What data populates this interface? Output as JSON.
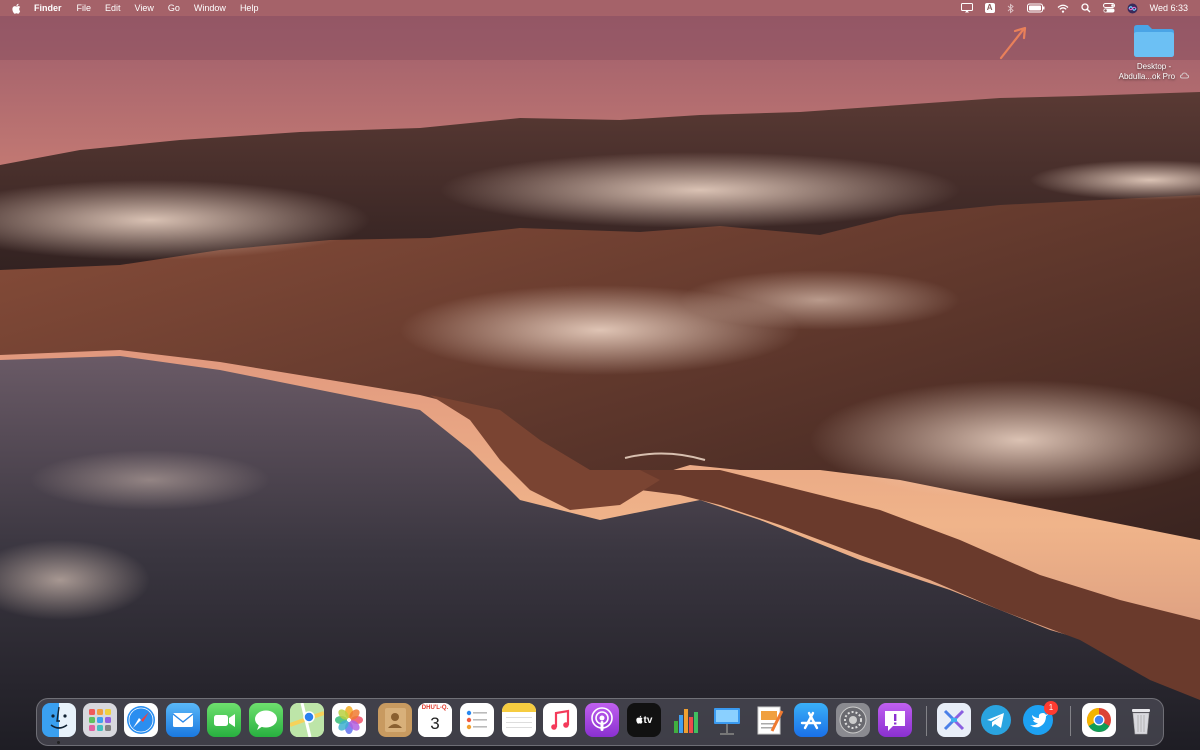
{
  "menubar": {
    "apple_icon": "apple-logo-icon",
    "app_name": "Finder",
    "menus": [
      "File",
      "Edit",
      "View",
      "Go",
      "Window",
      "Help"
    ],
    "status_icons": [
      "screen-mirroring-icon",
      "input-source-icon",
      "bluetooth-icon",
      "battery-icon",
      "wifi-icon",
      "spotlight-search-icon",
      "control-center-icon",
      "siri-icon"
    ],
    "input_source": "A",
    "clock": "Wed 6:33"
  },
  "desktop": {
    "items": [
      {
        "label_line1": "Desktop -",
        "label_line2": "Abdulla...ok Pro",
        "icon": "folder-icon",
        "status_icon": "icloud-icon"
      }
    ]
  },
  "annotation": {
    "icon": "arrow-icon",
    "color": "#e9805a"
  },
  "dock": {
    "apps": [
      {
        "name": "Finder",
        "icon": "finder-icon",
        "running": true
      },
      {
        "name": "Launchpad",
        "icon": "launchpad-icon"
      },
      {
        "name": "Safari",
        "icon": "safari-icon"
      },
      {
        "name": "Mail",
        "icon": "mail-icon"
      },
      {
        "name": "FaceTime",
        "icon": "facetime-icon"
      },
      {
        "name": "Messages",
        "icon": "messages-icon"
      },
      {
        "name": "Maps",
        "icon": "maps-icon"
      },
      {
        "name": "Photos",
        "icon": "photos-icon"
      },
      {
        "name": "Contacts",
        "icon": "contacts-icon"
      },
      {
        "name": "Calendar",
        "icon": "calendar-icon",
        "month": "DHU'L-Q.",
        "day": "3"
      },
      {
        "name": "Reminders",
        "icon": "reminders-icon"
      },
      {
        "name": "Notes",
        "icon": "notes-icon"
      },
      {
        "name": "Music",
        "icon": "music-icon"
      },
      {
        "name": "Podcasts",
        "icon": "podcasts-icon"
      },
      {
        "name": "TV",
        "icon": "tv-icon",
        "label": "tv"
      },
      {
        "name": "Numbers",
        "icon": "numbers-icon"
      },
      {
        "name": "Keynote",
        "icon": "keynote-icon"
      },
      {
        "name": "Pages",
        "icon": "pages-icon"
      },
      {
        "name": "App Store",
        "icon": "app-store-icon"
      },
      {
        "name": "System Preferences",
        "icon": "system-preferences-icon"
      },
      {
        "name": "Feedback Assistant",
        "icon": "feedback-assistant-icon"
      },
      {
        "name": "Screens",
        "icon": "screens-icon"
      },
      {
        "name": "Telegram",
        "icon": "telegram-icon"
      },
      {
        "name": "Twitter",
        "icon": "twitter-icon",
        "badge": "1"
      },
      {
        "name": "Google Chrome",
        "icon": "chrome-icon"
      },
      {
        "name": "Trash",
        "icon": "trash-icon"
      }
    ]
  },
  "colors": {
    "menubar_bg": "#b46e6e",
    "badge": "#ff3b30",
    "folder": "#5ab4f0"
  }
}
